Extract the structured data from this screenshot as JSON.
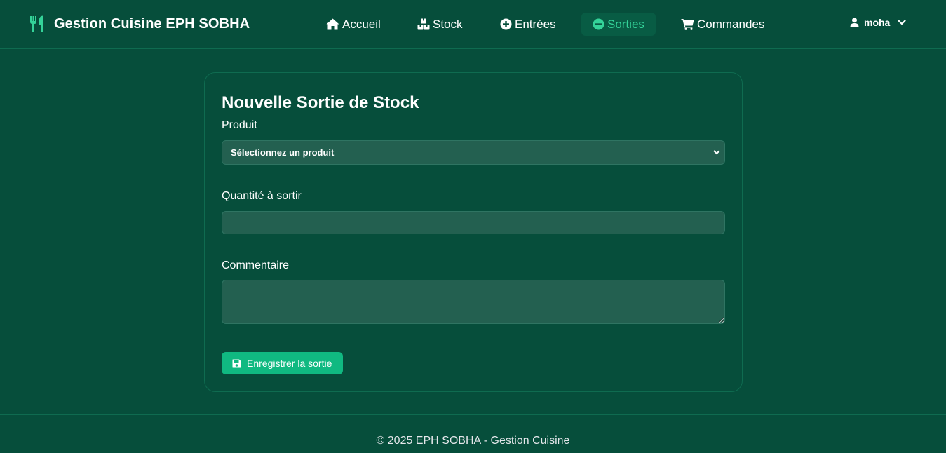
{
  "brand": {
    "title": "Gestion Cuisine EPH SOBHA",
    "icon": "utensils-icon"
  },
  "nav": {
    "items": [
      {
        "label": "Accueil",
        "icon": "home-icon",
        "active": false
      },
      {
        "label": "Stock",
        "icon": "boxes-icon",
        "active": false
      },
      {
        "label": "Entrées",
        "icon": "plus-circle-icon",
        "active": false
      },
      {
        "label": "Sorties",
        "icon": "minus-circle-icon",
        "active": true
      },
      {
        "label": "Commandes",
        "icon": "cart-icon",
        "active": false
      }
    ]
  },
  "user": {
    "name": "moha",
    "icon": "user-icon"
  },
  "form": {
    "title": "Nouvelle Sortie de Stock",
    "product_label": "Produit",
    "product_selected": "Sélectionnez un produit",
    "quantity_label": "Quantité à sortir",
    "quantity_value": "",
    "comment_label": "Commentaire",
    "comment_value": "",
    "submit_label": "Enregistrer la sortie"
  },
  "footer": {
    "text": "© 2025 EPH SOBHA - Gestion Cuisine"
  },
  "colors": {
    "background": "#064e3b",
    "accent": "#10b981",
    "active_text": "#34d399",
    "field_bg": "#236050"
  }
}
